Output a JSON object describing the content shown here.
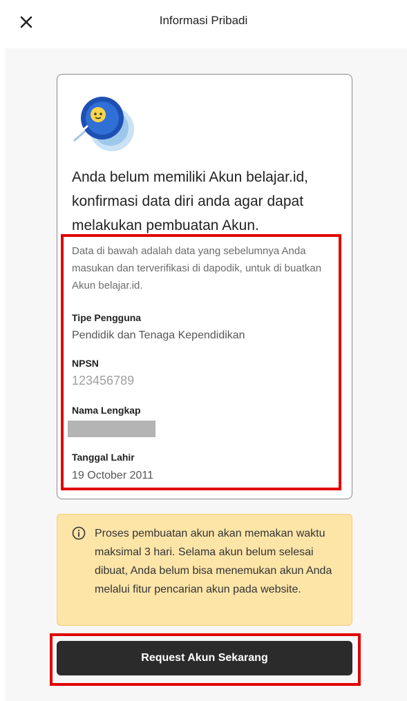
{
  "header": {
    "title": "Informasi Pribadi",
    "close_icon": "close-icon"
  },
  "card": {
    "icon": "avatar-coin-icon",
    "headline": "Anda belum memiliki Akun belajar.id, konfirmasi data diri anda agar dapat melakukan pembuatan Akun.",
    "description": "Data di bawah adalah data yang sebelumnya Anda masukan dan terverifikasi di dapodik, untuk di buatkan Akun belajar.id.",
    "fields": [
      {
        "label": "Tipe Pengguna",
        "value": "Pendidik dan Tenaga Kependidikan"
      },
      {
        "label": "NPSN",
        "value": "123456789"
      },
      {
        "label": "Nama Lengkap",
        "value": ""
      },
      {
        "label": "Tanggal Lahir",
        "value": "19 October 2011"
      }
    ]
  },
  "notice": {
    "icon": "info-icon",
    "text": "Proses pembuatan akun akan memakan waktu maksimal 3 hari. Selama akun belum selesai dibuat, Anda belum bisa menemukan akun Anda melalui fitur pencarian akun pada website."
  },
  "actions": {
    "request_label": "Request Akun Sekarang"
  },
  "colors": {
    "highlight": "#e00000",
    "notice_bg": "#fde5a8",
    "button_bg": "#2b2b2b"
  }
}
